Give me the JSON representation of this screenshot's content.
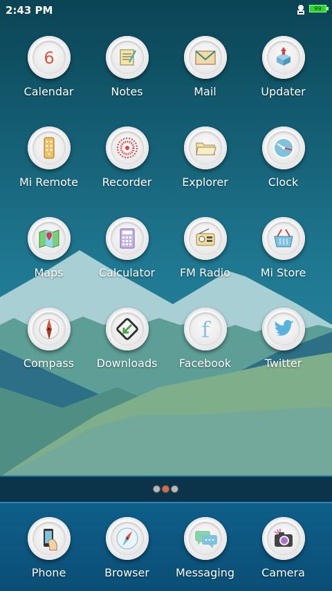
{
  "status_bar": {
    "time": "2:43 PM",
    "battery_level": "99"
  },
  "colors": {
    "sky_top": "#0b4a5c",
    "sky_bottom": "#2a8aa3",
    "dock": "#0e5f8a",
    "active_dot": "#e26a3a"
  },
  "apps": [
    {
      "label": "Calendar",
      "icon": "calendar-icon",
      "glyph": "6"
    },
    {
      "label": "Notes",
      "icon": "notes-icon"
    },
    {
      "label": "Mail",
      "icon": "mail-icon"
    },
    {
      "label": "Updater",
      "icon": "updater-icon"
    },
    {
      "label": "Mi Remote",
      "icon": "remote-icon"
    },
    {
      "label": "Recorder",
      "icon": "recorder-icon"
    },
    {
      "label": "Explorer",
      "icon": "folder-icon"
    },
    {
      "label": "Clock",
      "icon": "clock-icon"
    },
    {
      "label": "Maps",
      "icon": "map-icon"
    },
    {
      "label": "Calculator",
      "icon": "calculator-icon"
    },
    {
      "label": "FM Radio",
      "icon": "radio-icon"
    },
    {
      "label": "Mi Store",
      "icon": "basket-icon"
    },
    {
      "label": "Compass",
      "icon": "compass-icon"
    },
    {
      "label": "Downloads",
      "icon": "download-icon"
    },
    {
      "label": "Facebook",
      "icon": "facebook-icon",
      "glyph": "f"
    },
    {
      "label": "Twitter",
      "icon": "twitter-icon"
    }
  ],
  "page_indicator": {
    "pages": 3,
    "current": 2
  },
  "dock": [
    {
      "label": "Phone",
      "icon": "phone-icon"
    },
    {
      "label": "Browser",
      "icon": "browser-icon"
    },
    {
      "label": "Messaging",
      "icon": "messaging-icon"
    },
    {
      "label": "Camera",
      "icon": "camera-icon"
    }
  ]
}
